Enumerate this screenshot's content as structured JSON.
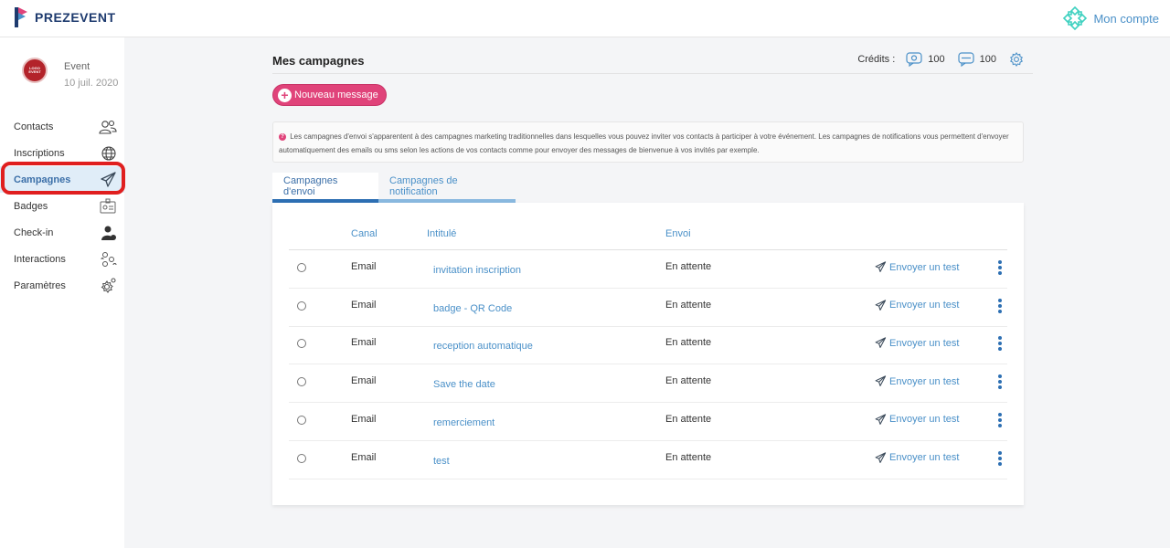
{
  "brand": {
    "name": "PREZEVENT"
  },
  "account": {
    "label": "Mon compte"
  },
  "event": {
    "logo_text": "LOGO EVENT",
    "name": "Event",
    "date": "10 juil. 2020"
  },
  "sidebar": {
    "items": [
      {
        "label": "Contacts",
        "icon": "contacts-icon"
      },
      {
        "label": "Inscriptions",
        "icon": "globe-icon"
      },
      {
        "label": "Campagnes",
        "icon": "paper-plane-icon",
        "active": true
      },
      {
        "label": "Badges",
        "icon": "badge-icon"
      },
      {
        "label": "Check-in",
        "icon": "checkin-icon"
      },
      {
        "label": "Interactions",
        "icon": "interactions-icon"
      },
      {
        "label": "Paramètres",
        "icon": "gear-icon"
      }
    ]
  },
  "page": {
    "title": "Mes campagnes",
    "credits_label": "Crédits :",
    "credits_email": "100",
    "credits_sms": "100",
    "new_button": "Nouveau message",
    "info": "Les campagnes d'envoi s'apparentent à des campagnes marketing traditionnelles dans lesquelles vous pouvez inviter vos contacts à participer à votre événement. Les campagnes de notifications vous permettent d'envoyer automatiquement des emails ou sms selon les actions de vos contacts comme pour envoyer des messages de bienvenue à vos invités par exemple."
  },
  "tabs": [
    {
      "label": "Campagnes d'envoi",
      "active": true
    },
    {
      "label": "Campagnes de notification",
      "active": false
    }
  ],
  "table": {
    "columns": {
      "canal": "Canal",
      "intitule": "Intitulé",
      "envoi": "Envoi"
    },
    "test_label": "Envoyer un test",
    "rows": [
      {
        "canal": "Email",
        "title": "invitation inscription",
        "envoi": "En attente"
      },
      {
        "canal": "Email",
        "title": "badge - QR Code",
        "envoi": "En attente"
      },
      {
        "canal": "Email",
        "title": "reception automatique",
        "envoi": "En attente"
      },
      {
        "canal": "Email",
        "title": "Save the date",
        "envoi": "En attente"
      },
      {
        "canal": "Email",
        "title": "remerciement",
        "envoi": "En attente"
      },
      {
        "canal": "Email",
        "title": "test",
        "envoi": "En attente"
      }
    ]
  },
  "colors": {
    "accent": "#e0437a",
    "link": "#4a90c8",
    "primary": "#2d6fb3",
    "highlight": "#e01f1f"
  }
}
